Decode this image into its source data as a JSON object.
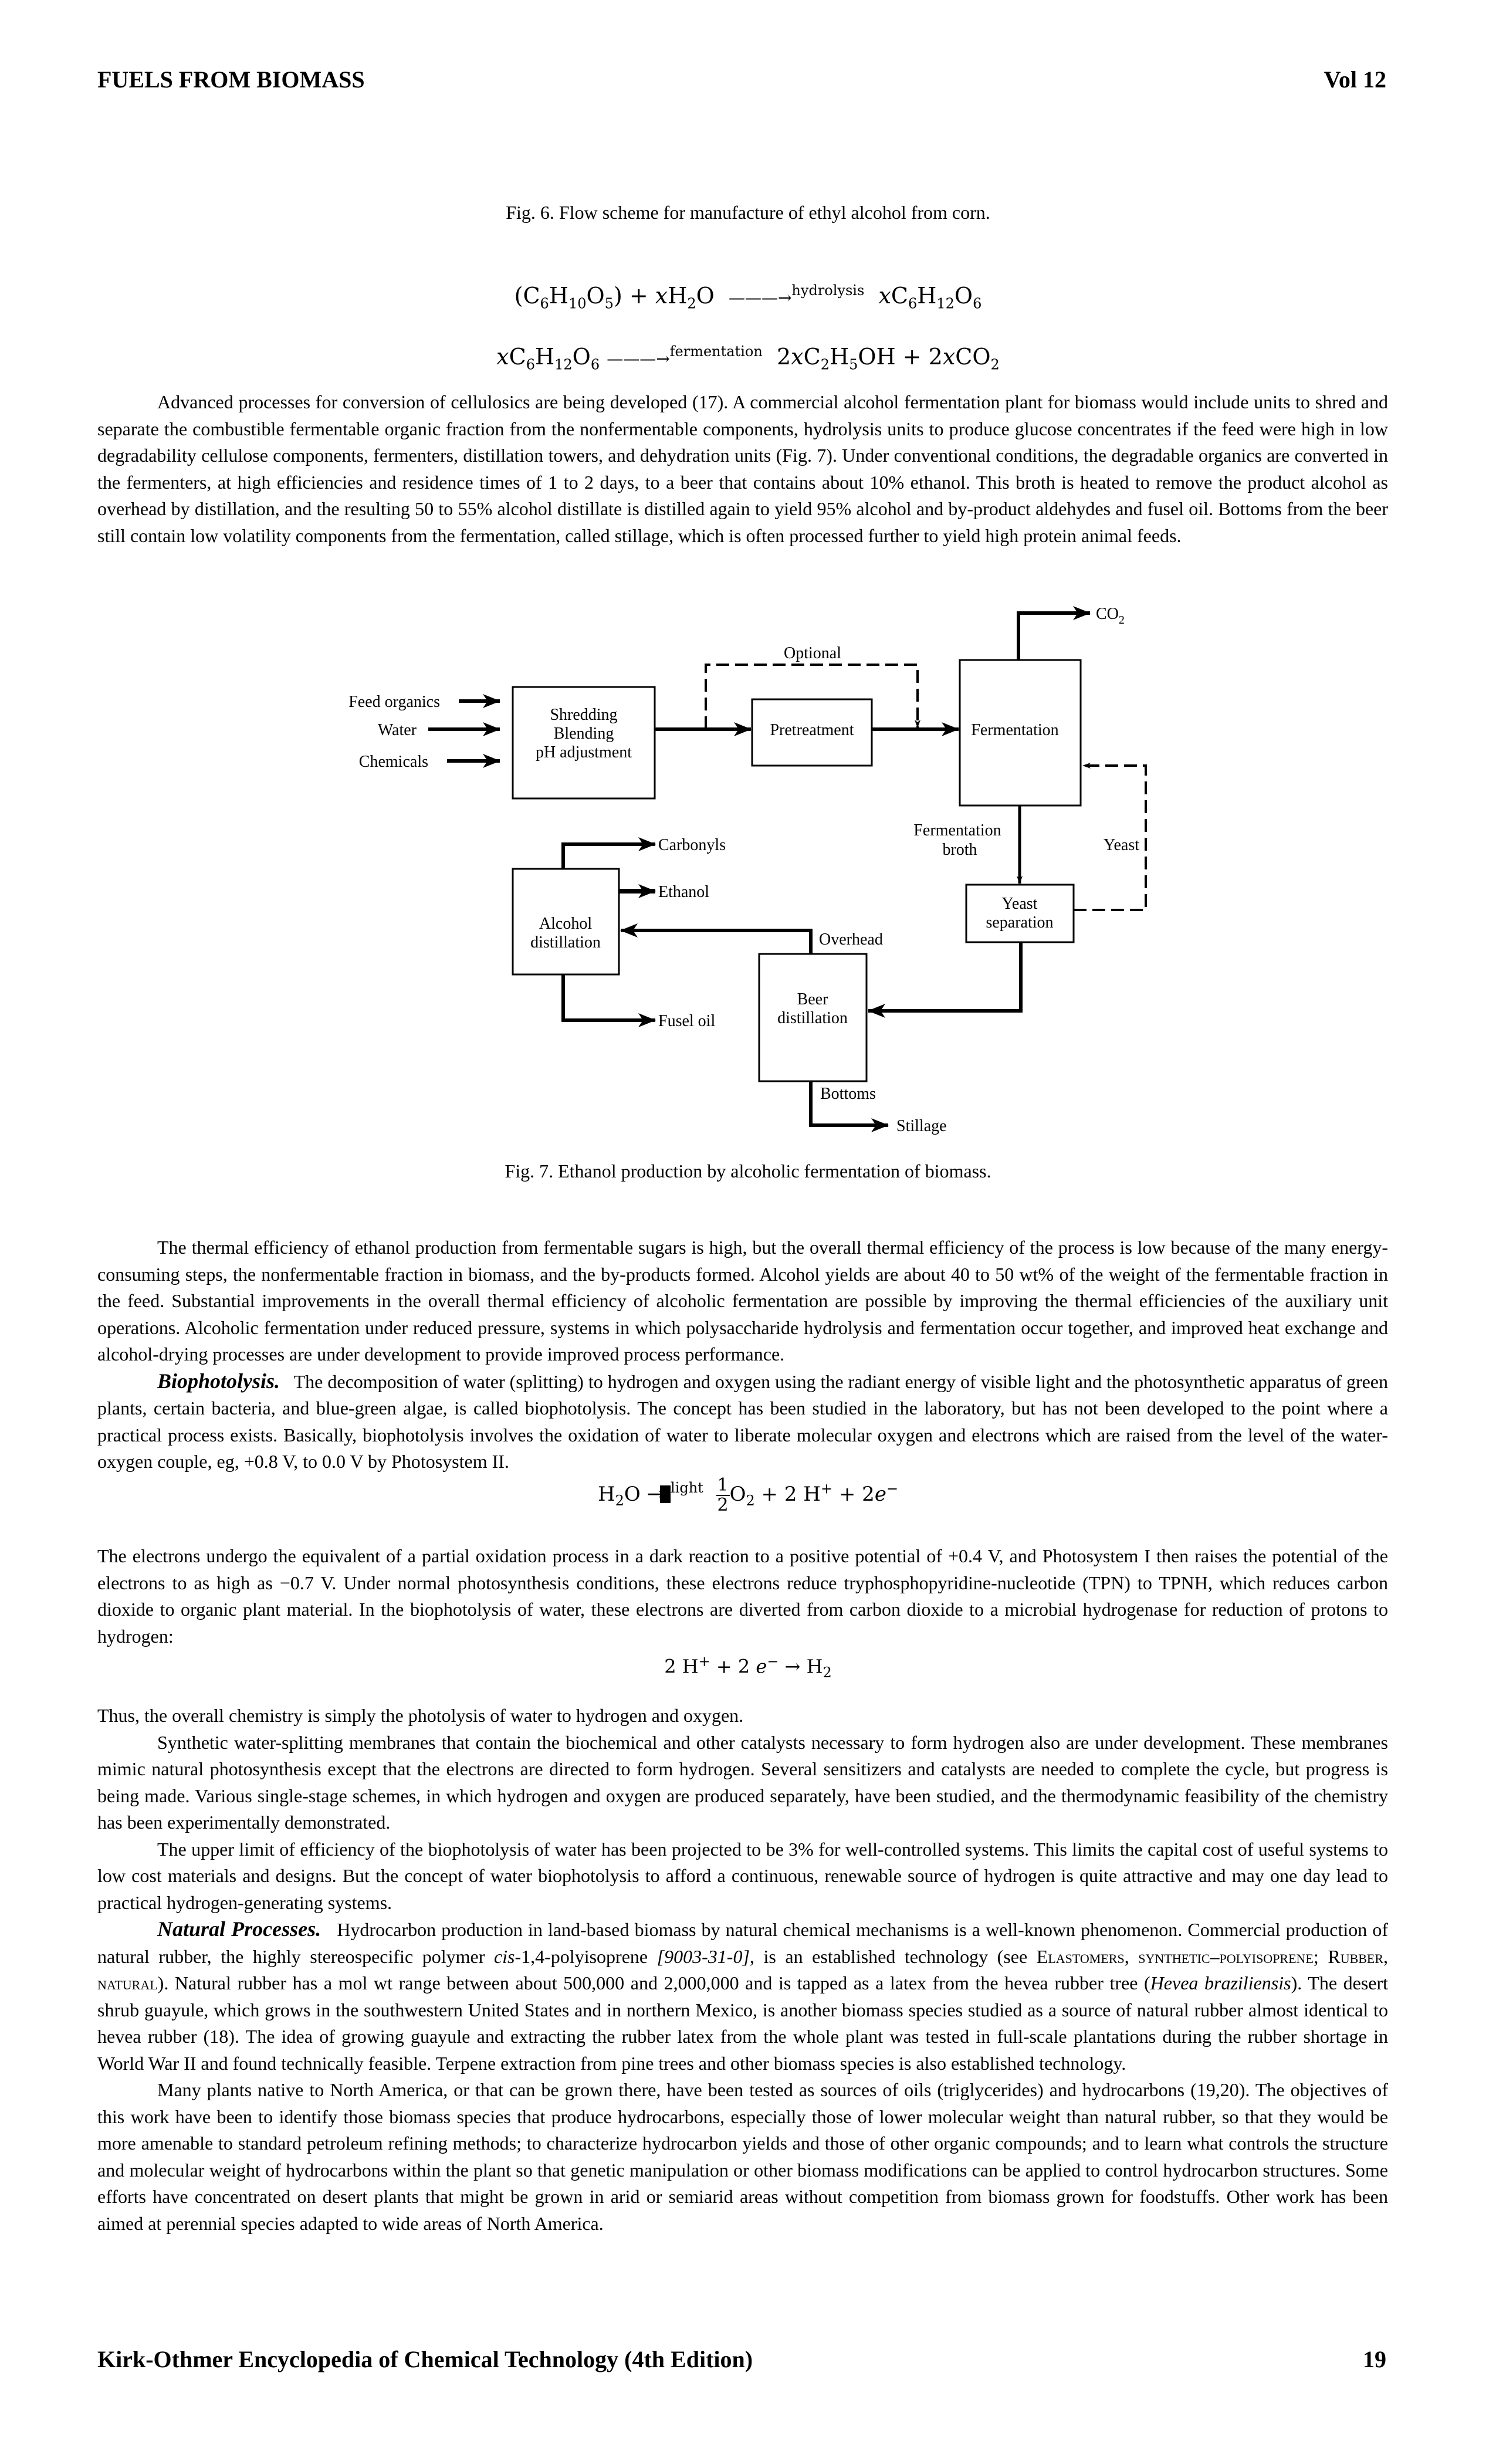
{
  "header": {
    "title": "FUELS FROM BIOMASS",
    "volume": "Vol 12"
  },
  "fig6": {
    "caption": "Fig. 6. Flow scheme for manufacture of ethyl alcohol from corn."
  },
  "equations": {
    "hydrolysis": {
      "lhs_1": "(C",
      "lhs_1_sub_a": "6",
      "lhs_1_h": "H",
      "lhs_1_sub_b": "10",
      "lhs_1_o": "O",
      "lhs_1_sub_c": "5",
      "lhs_1_close": ") + ",
      "lhs_x": "x",
      "lhs_2": "H",
      "lhs_2_sub": "2",
      "lhs_2_end": "O",
      "arrow": "———→",
      "over": "hydrolysis",
      "rhs_x": "x",
      "rhs": "C",
      "rhs_sub_a": "6",
      "rhs_h": "H",
      "rhs_sub_b": "12",
      "rhs_o": "O",
      "rhs_sub_c": "6"
    },
    "fermentation": {
      "lhs_x": "x",
      "lhs": "C",
      "lhs_sub_a": "6",
      "lhs_h": "H",
      "lhs_sub_b": "12",
      "lhs_o": "O",
      "lhs_sub_c": "6",
      "arrow": "———→",
      "over": "fermentation",
      "rhs_coef": "2",
      "rhs_x": "x",
      "rhs_c": "C",
      "rhs_sub_a": "2",
      "rhs_h": "H",
      "rhs_sub_b": "5",
      "rhs_oh": "OH + 2",
      "rhs_x2": "x",
      "rhs_co": "CO",
      "rhs_sub_c": "2"
    },
    "biophotolysis": {
      "lhs": "H",
      "lhs_sub": "2",
      "lhs_end": "O →",
      "over": "light",
      "frac_num": "1",
      "frac_den": "2",
      "rhs_o": "O",
      "rhs_o_sub": "2",
      "rhs_mid": " + 2 H",
      "rhs_plus_sup": "+",
      "rhs_mid2": " + 2",
      "rhs_e": "e",
      "rhs_e_sup": "−"
    },
    "hydrogenase": {
      "text_a": "2 H",
      "sup_a": "+",
      "text_b": " + 2 ",
      "e": "e",
      "sup_b": "−",
      "text_c": " → H",
      "sub": "2"
    }
  },
  "paragraphs": {
    "p1": "Advanced processes for conversion of cellulosics are being developed (17). A commercial alcohol fermentation plant for biomass would include units to shred and separate the combustible fermentable organic fraction from the nonfermentable components, hydrolysis units to produce glucose concentrates if the feed were high in low degradability cellulose components, fermenters, distillation towers, and dehydration units (Fig. 7). Under conventional conditions, the degradable organics are converted in the fermenters, at high efficiencies and residence times of 1 to 2 days, to a beer that contains about 10% ethanol. This broth is heated to remove the product alcohol as overhead by distillation, and the resulting 50 to 55% alcohol distillate is distilled again to yield 95% alcohol and by-product aldehydes and fusel oil. Bottoms from the beer still contain low volatility components from the fermentation, called stillage, which is often processed further to yield high protein animal feeds.",
    "p2": "The thermal efficiency of ethanol production from fermentable sugars is high, but the overall thermal efficiency of the process is low because of the many energy-consuming steps, the nonfermentable fraction in biomass, and the by-products formed. Alcohol yields are about 40 to 50 wt% of the weight of the fermentable fraction in the feed. Substantial improvements in the overall thermal efficiency of alcoholic fermentation are possible by improving the thermal efficiencies of the auxiliary unit operations. Alcoholic fermentation under reduced pressure, systems in which polysaccharide hydrolysis and fermentation occur together, and improved heat exchange and alcohol-drying processes are under development to provide improved process performance.",
    "p3_heading": "Biophotolysis.",
    "p3": "The decomposition of water (splitting) to hydrogen and oxygen using the radiant energy of visible light and the photosynthetic apparatus of green plants, certain bacteria, and blue-green algae, is called biophotolysis. The concept has been studied in the laboratory, but has not been developed to the point where a practical process exists. Basically, biophotolysis involves the oxidation of water to liberate molecular oxygen and electrons which are raised from the level of the water-oxygen couple, eg, +0.8 V, to 0.0 V by Photosystem II.",
    "p4": "The electrons undergo the equivalent of a partial oxidation process in a dark reaction to a positive potential of +0.4 V, and Photosystem I then raises the potential of the electrons to as high as −0.7 V. Under normal photosynthesis conditions, these electrons reduce tryphosphopyridine-nucleotide (TPN) to TPNH, which reduces carbon dioxide to organic plant material. In the biophotolysis of water, these electrons are diverted from carbon dioxide to a microbial hydrogenase for reduction of protons to hydrogen:",
    "p5": "Thus, the overall chemistry is simply the photolysis of water to hydrogen and oxygen.",
    "p6": "Synthetic water-splitting membranes that contain the biochemical and other catalysts necessary to form hydrogen also are under development. These membranes mimic natural photosynthesis except that the electrons are directed to form hydrogen. Several sensitizers and catalysts are needed to complete the cycle, but progress is being made. Various single-stage schemes, in which hydrogen and oxygen are produced separately, have been studied, and the thermodynamic feasibility of the chemistry has been experimentally demonstrated.",
    "p7": "The upper limit of efficiency of the biophotolysis of water has been projected to be 3% for well-controlled systems. This limits the capital cost of useful systems to low cost materials and designs. But the concept of water biophotolysis to afford a continuous, renewable source of hydrogen is quite attractive and may one day lead to practical hydrogen-generating systems.",
    "p8_heading": "Natural Processes.",
    "p8_a": "Hydrocarbon production in land-based biomass by natural chemical mechanisms is a well-known phenomenon. Commercial production of natural rubber, the highly stereospecific polymer ",
    "p8_cis": "cis",
    "p8_b": "-1,4-polyisoprene ",
    "p8_cas": "[9003-31-0]",
    "p8_c": ", is an established technology (see ",
    "p8_xref1": "Elastomers, synthetic–polyisoprene",
    "p8_d": "; ",
    "p8_xref2": "Rubber, natural",
    "p8_e": "). Natural rubber has a mol wt range between about 500,000 and 2,000,000 and is tapped as a latex from the hevea rubber tree (",
    "p8_species": "Hevea braziliensis",
    "p8_f": "). The desert shrub guayule, which grows in the southwestern United States and in northern Mexico, is another biomass species studied as a source of natural rubber almost identical to hevea rubber (18). The idea of growing guayule and extracting the rubber latex from the whole plant was tested in full-scale plantations during the rubber shortage in World War II and found technically feasible. Terpene extraction from pine trees and other biomass species is also established technology.",
    "p9": "Many plants native to North America, or that can be grown there, have been tested as sources of oils (triglycerides) and hydrocarbons (19,20). The objectives of this work have been to identify those biomass species that produce hydrocarbons, especially those of lower molecular weight than natural rubber, so that they would be more amenable to standard petroleum refining methods; to characterize hydrocarbon yields and those of other organic compounds; and to learn what controls the structure and molecular weight of hydrocarbons within the plant so that genetic manipulation or other biomass modifications can be applied to control hydrocarbon structures. Some efforts have concentrated on desert plants that might be grown in arid or semiarid areas without competition from biomass grown for foodstuffs. Other work has been aimed at perennial species adapted to wide areas of North America."
  },
  "fig7": {
    "caption": "Fig. 7. Ethanol production by alcoholic fermentation of biomass.",
    "inputs": [
      "Feed organics",
      "Water",
      "Chemicals"
    ],
    "boxes": {
      "shredding": [
        "Shredding",
        "Blending",
        "pH adjustment"
      ],
      "pretreatment": "Pretreatment",
      "fermentation": "Fermentation",
      "yeast_separation": [
        "Yeast",
        "separation"
      ],
      "beer_distillation": [
        "Beer",
        "distillation"
      ],
      "alcohol_distillation": [
        "Alcohol",
        "distillation"
      ]
    },
    "labels": {
      "optional": "Optional",
      "co2": "CO",
      "co2_sub": "2",
      "fermentation_broth": [
        "Fermentation",
        "broth"
      ],
      "yeast": "Yeast",
      "carbonyls": "Carbonyls",
      "ethanol": "Ethanol",
      "overhead": "Overhead",
      "fusel_oil": "Fusel oil",
      "bottoms": "Bottoms",
      "stillage": "Stillage"
    }
  },
  "footer": {
    "source": "Kirk-Othmer Encyclopedia of Chemical Technology (4th Edition)",
    "page": "19"
  }
}
